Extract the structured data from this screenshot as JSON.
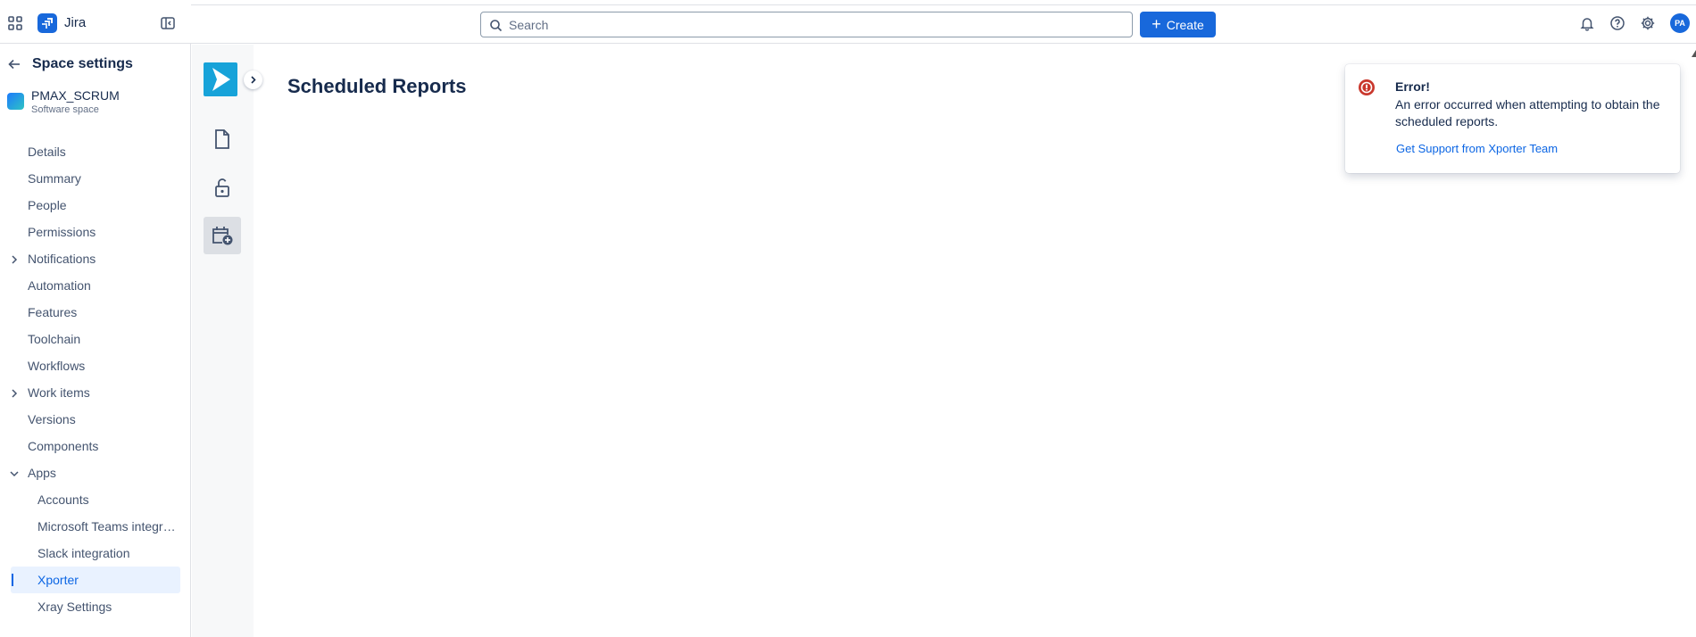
{
  "topbar": {
    "app_name": "Jira",
    "search_placeholder": "Search",
    "create_label": "Create",
    "avatar_initials": "PA",
    "brand_color": "#1868db"
  },
  "sidebar": {
    "back_title": "Space settings",
    "space_name": "PMAX_SCRUM",
    "space_type": "Software space",
    "items": [
      {
        "label": "Details"
      },
      {
        "label": "Summary"
      },
      {
        "label": "People"
      },
      {
        "label": "Permissions"
      },
      {
        "label": "Notifications",
        "expandable": true
      },
      {
        "label": "Automation"
      },
      {
        "label": "Features"
      },
      {
        "label": "Toolchain"
      },
      {
        "label": "Workflows"
      },
      {
        "label": "Work items",
        "expandable": true
      },
      {
        "label": "Versions"
      },
      {
        "label": "Components"
      },
      {
        "label": "Apps",
        "expanded": true
      }
    ],
    "apps": [
      {
        "label": "Accounts"
      },
      {
        "label": "Microsoft Teams integration"
      },
      {
        "label": "Slack integration"
      },
      {
        "label": "Xporter",
        "selected": true
      },
      {
        "label": "Xray Settings"
      }
    ]
  },
  "main": {
    "title": "Scheduled Reports"
  },
  "flag": {
    "title": "Error!",
    "message": "An error occurred when attempting to obtain the scheduled reports.",
    "link": "Get Support from Xporter Team",
    "error_color": "#c9372c"
  }
}
